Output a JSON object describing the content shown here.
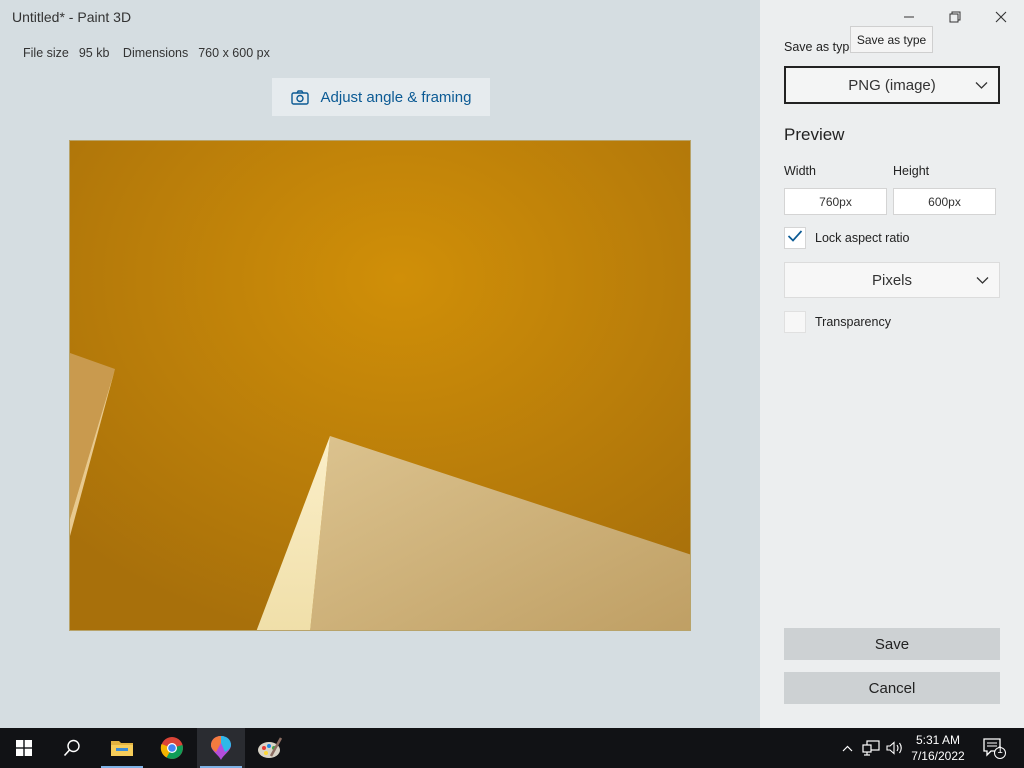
{
  "window": {
    "title": "Untitled* - Paint 3D",
    "minimize_icon": "minimize-icon",
    "restore_icon": "restore-icon",
    "close_icon": "close-icon"
  },
  "file_info": {
    "size_label": "File size",
    "size_value": "95 kb",
    "dimensions_label": "Dimensions",
    "dimensions_value": "760 x 600 px"
  },
  "adjust_button": {
    "label": "Adjust angle & framing",
    "icon": "camera-icon"
  },
  "tooltip": "Save as type",
  "panel": {
    "save_as_type_label": "Save as type",
    "save_as_type_value": "PNG (image)",
    "preview_heading": "Preview",
    "width_label": "Width",
    "height_label": "Height",
    "width_value": "760px",
    "height_value": "600px",
    "lock_aspect_label": "Lock aspect ratio",
    "lock_aspect_checked": true,
    "units_value": "Pixels",
    "transparency_label": "Transparency",
    "transparency_checked": false,
    "save_button": "Save",
    "cancel_button": "Cancel"
  },
  "taskbar": {
    "apps": [
      "windows-start-icon",
      "search-icon",
      "file-explorer-icon",
      "chrome-icon",
      "paint-3d-icon",
      "paint-palette-icon"
    ],
    "active_app": "paint-3d-icon",
    "time": "5:31 AM",
    "date": "7/16/2022",
    "notification_count": "1"
  },
  "colors": {
    "accent": "#0b5a94",
    "image_background": "#c8880a",
    "panel_background": "#eceeef",
    "taskbar": "#111215"
  }
}
